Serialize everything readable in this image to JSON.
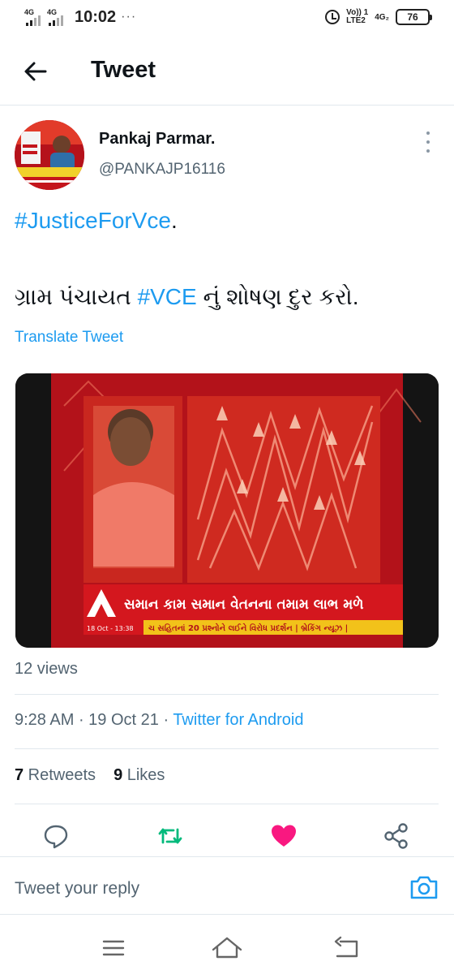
{
  "status_bar": {
    "net1": "4G",
    "net2": "4G",
    "time": "10:02",
    "dots": "···",
    "lte_top": "Vo)) 1",
    "lte_bottom": "LTE2",
    "net3": "4G₂",
    "battery": "76"
  },
  "header": {
    "title": "Tweet",
    "back_icon": "arrow-left-icon"
  },
  "tweet": {
    "author_name": "Pankaj Parmar.",
    "author_handle": "@PANKAJP16116",
    "line1_hashtag": "#JusticeForVce",
    "line1_suffix": ".",
    "line2_prefix": "ગ્રામ પંચાયત ",
    "line2_hashtag": "#VCE",
    "line2_suffix": " નું શોષણ દુર કરો.",
    "translate_label": "Translate Tweet",
    "media": {
      "ticker_main": "સમાન કામ સમાન વેતનના તમામ લાભ મળે",
      "ticker_date": "18 Oct - 13:38",
      "ticker_sub": "ચ સહિતનાં 20 પ્રશ્નોને લઈને વિરોધ પ્રદર્શન | બ્રેકિંગ ન્યૂઝ |"
    },
    "views": "12 views",
    "time": "9:28 AM",
    "date": "19 Oct 21",
    "source": "Twitter for Android",
    "separator": " · ",
    "retweets_count": "7",
    "retweets_label": " Retweets",
    "likes_count": "9",
    "likes_label": " Likes"
  },
  "actions": {
    "reply_icon": "reply-icon",
    "retweet_icon": "retweet-icon",
    "like_icon": "heart-icon",
    "share_icon": "share-icon",
    "retweet_color": "#00ba7c",
    "like_color": "#f91880"
  },
  "reply": {
    "placeholder": "Tweet your reply",
    "camera_icon": "camera-icon"
  },
  "nav": {
    "menu_icon": "menu-icon",
    "home_icon": "home-icon",
    "back_icon": "back-icon"
  },
  "colors": {
    "accent": "#1d9bf0",
    "text": "#0f1419",
    "muted": "#536471"
  }
}
